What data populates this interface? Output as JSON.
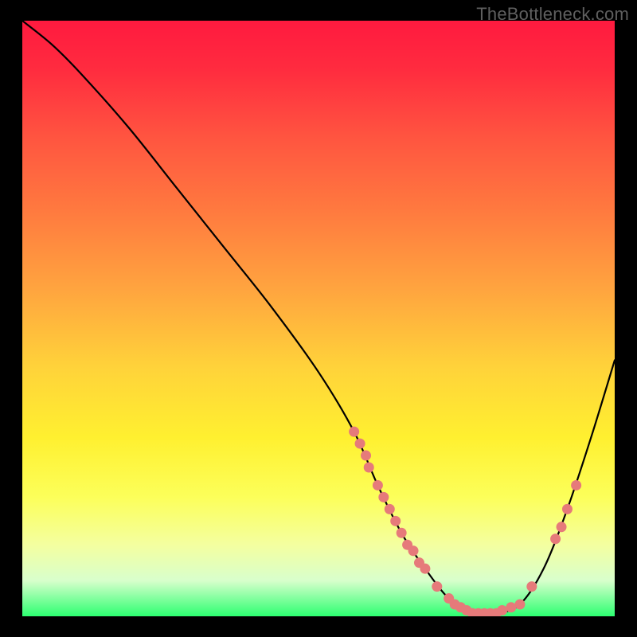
{
  "watermark": "TheBottleneck.com",
  "colors": {
    "curve": "#000000",
    "marker_fill": "#e67a7a",
    "marker_stroke": "#c25a5a",
    "gradient_top": "#ff1a3f",
    "gradient_bottom": "#2dff71"
  },
  "chart_data": {
    "type": "line",
    "title": "",
    "xlabel": "",
    "ylabel": "",
    "xlim": [
      0,
      100
    ],
    "ylim": [
      0,
      100
    ],
    "curve": {
      "x": [
        0,
        5,
        10,
        18,
        26,
        34,
        42,
        50,
        56,
        60,
        64,
        68,
        72,
        76,
        80,
        84,
        88,
        92,
        96,
        100
      ],
      "y": [
        100,
        96,
        91,
        82,
        72,
        62,
        52,
        41,
        31,
        22,
        14,
        8,
        3,
        0.5,
        0.5,
        2,
        8,
        18,
        30,
        43
      ]
    },
    "markers": [
      {
        "x": 56,
        "y": 31
      },
      {
        "x": 57,
        "y": 29
      },
      {
        "x": 58,
        "y": 27
      },
      {
        "x": 58.5,
        "y": 25
      },
      {
        "x": 60,
        "y": 22
      },
      {
        "x": 61,
        "y": 20
      },
      {
        "x": 62,
        "y": 18
      },
      {
        "x": 63,
        "y": 16
      },
      {
        "x": 64,
        "y": 14
      },
      {
        "x": 65,
        "y": 12
      },
      {
        "x": 66,
        "y": 11
      },
      {
        "x": 67,
        "y": 9
      },
      {
        "x": 68,
        "y": 8
      },
      {
        "x": 70,
        "y": 5
      },
      {
        "x": 72,
        "y": 3
      },
      {
        "x": 73,
        "y": 2
      },
      {
        "x": 74,
        "y": 1.5
      },
      {
        "x": 75,
        "y": 1
      },
      {
        "x": 76,
        "y": 0.5
      },
      {
        "x": 77,
        "y": 0.5
      },
      {
        "x": 78,
        "y": 0.5
      },
      {
        "x": 79,
        "y": 0.5
      },
      {
        "x": 80,
        "y": 0.5
      },
      {
        "x": 81,
        "y": 1
      },
      {
        "x": 82.5,
        "y": 1.5
      },
      {
        "x": 84,
        "y": 2
      },
      {
        "x": 86,
        "y": 5
      },
      {
        "x": 90,
        "y": 13
      },
      {
        "x": 91,
        "y": 15
      },
      {
        "x": 92,
        "y": 18
      },
      {
        "x": 93.5,
        "y": 22
      }
    ]
  }
}
